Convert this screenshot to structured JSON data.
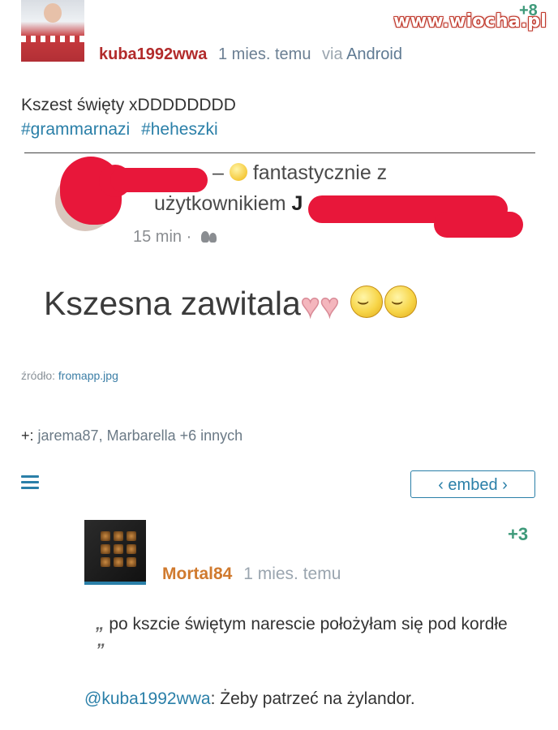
{
  "watermark": "www.wiocha.pl",
  "post": {
    "score": "+8",
    "author": "kuba1992wwa",
    "time": "1 mies. temu",
    "via": "via",
    "app": "Android",
    "text": "Kszest święty xDDDDDDDD",
    "hashtags": [
      "#grammarnazi",
      "#heheszki"
    ]
  },
  "embedded_image": {
    "line1_dash": "–",
    "line1_text": "fantastycznie z",
    "line2_text": "użytkownikiem",
    "line2_bold": "J",
    "meta_time": "15 min",
    "meta_sep": "·",
    "big_text": "Kszesna zawitala",
    "icons": [
      "laughing-emoji",
      "heart-icon",
      "heart-icon",
      "smile-emoji",
      "smile-emoji",
      "friends-icon"
    ]
  },
  "source": {
    "label": "źródło:",
    "file": "fromapp.jpg"
  },
  "plus": {
    "prefix": "+:",
    "users": "jarema87, Marbarella +6 innych"
  },
  "toolbar": {
    "embed_label": "‹ embed ›"
  },
  "comment": {
    "score": "+3",
    "author": "Mortal84",
    "time": "1 mies. temu",
    "quote_open": "„",
    "quote_text": "po kszcie świętym narescie położyłam się pod kordłe",
    "quote_close": "”",
    "reply_mention": "@kuba1992wwa",
    "reply_text": ": Żeby patrzeć na żylandor."
  },
  "colors": {
    "accent": "#2a7fa8",
    "author": "#b22b2b",
    "score": "#3e9a7a",
    "redaction": "#e8173a",
    "comment_author": "#d07a2e"
  }
}
